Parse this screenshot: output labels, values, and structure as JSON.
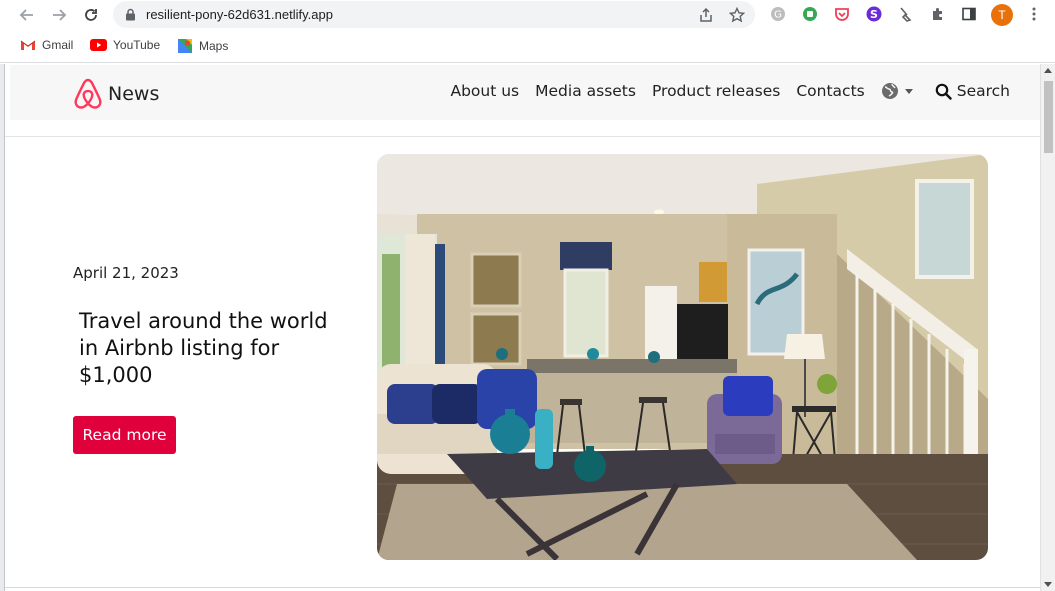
{
  "browser": {
    "url": "resilient-pony-62d631.netlify.app",
    "profile_initial": "T",
    "bookmarks": [
      {
        "label": "Gmail",
        "icon": "gmail-icon"
      },
      {
        "label": "YouTube",
        "icon": "youtube-icon"
      },
      {
        "label": "Maps",
        "icon": "maps-icon"
      }
    ],
    "extensions": [
      "grammarly-icon",
      "android-extension-icon",
      "pocket-icon",
      "purple-s-extension-icon",
      "broom-icon",
      "puzzle-icon",
      "sidepanel-icon"
    ]
  },
  "site": {
    "brand": "News",
    "brand_color": "#ff385c",
    "nav": [
      "About us",
      "Media assets",
      "Product releases",
      "Contacts"
    ],
    "search_label": "Search"
  },
  "article": {
    "date": "April 21, 2023",
    "title": "Travel around the world in Airbnb listing for $1,000",
    "button_label": "Read more",
    "button_color": "#e0003c",
    "image": "living-room-photo"
  }
}
